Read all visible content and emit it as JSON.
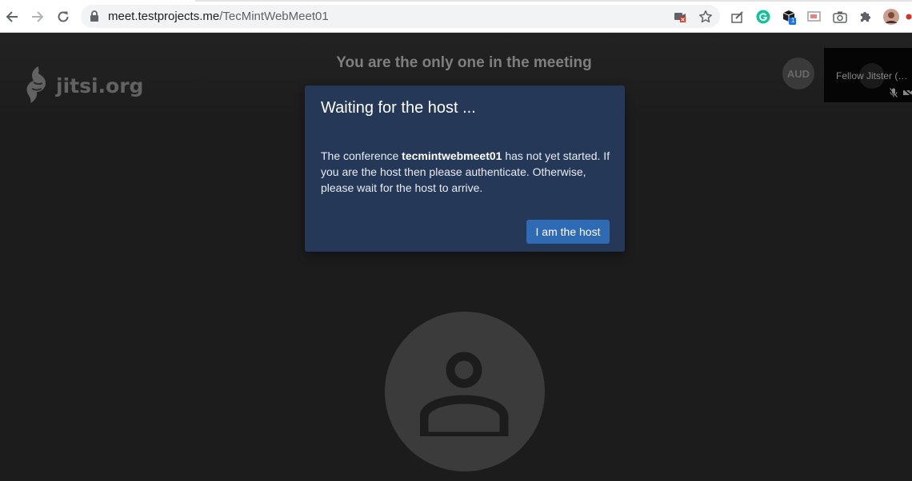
{
  "browser": {
    "url_host": "meet.testprojects.me",
    "url_path": "/TecMintWebMeet01",
    "extension_badge": "1"
  },
  "meeting": {
    "logo_text": "jitsi.org",
    "status_text": "You are the only one in the meeting",
    "avatar_initials": "AUD",
    "participant_name": "Fellow Jitster (…"
  },
  "dialog": {
    "title": "Waiting for the host ...",
    "message_prefix": "The conference ",
    "conference_name": "tecmintwebmeet01",
    "message_suffix": " has not yet started. If you are the host then please authenticate. Otherwise, please wait for the host to arrive.",
    "button_label": "I am the host"
  },
  "colors": {
    "dialog_bg": "#253858",
    "button_bg": "#2f6bb5",
    "stage_bg": "#1c1c1c"
  },
  "icons": {
    "back": "arrow-left-icon",
    "forward": "arrow-right-icon",
    "reload": "reload-icon",
    "lock": "lock-icon",
    "bookmark": "star-icon",
    "extensions": "puzzle-icon"
  }
}
